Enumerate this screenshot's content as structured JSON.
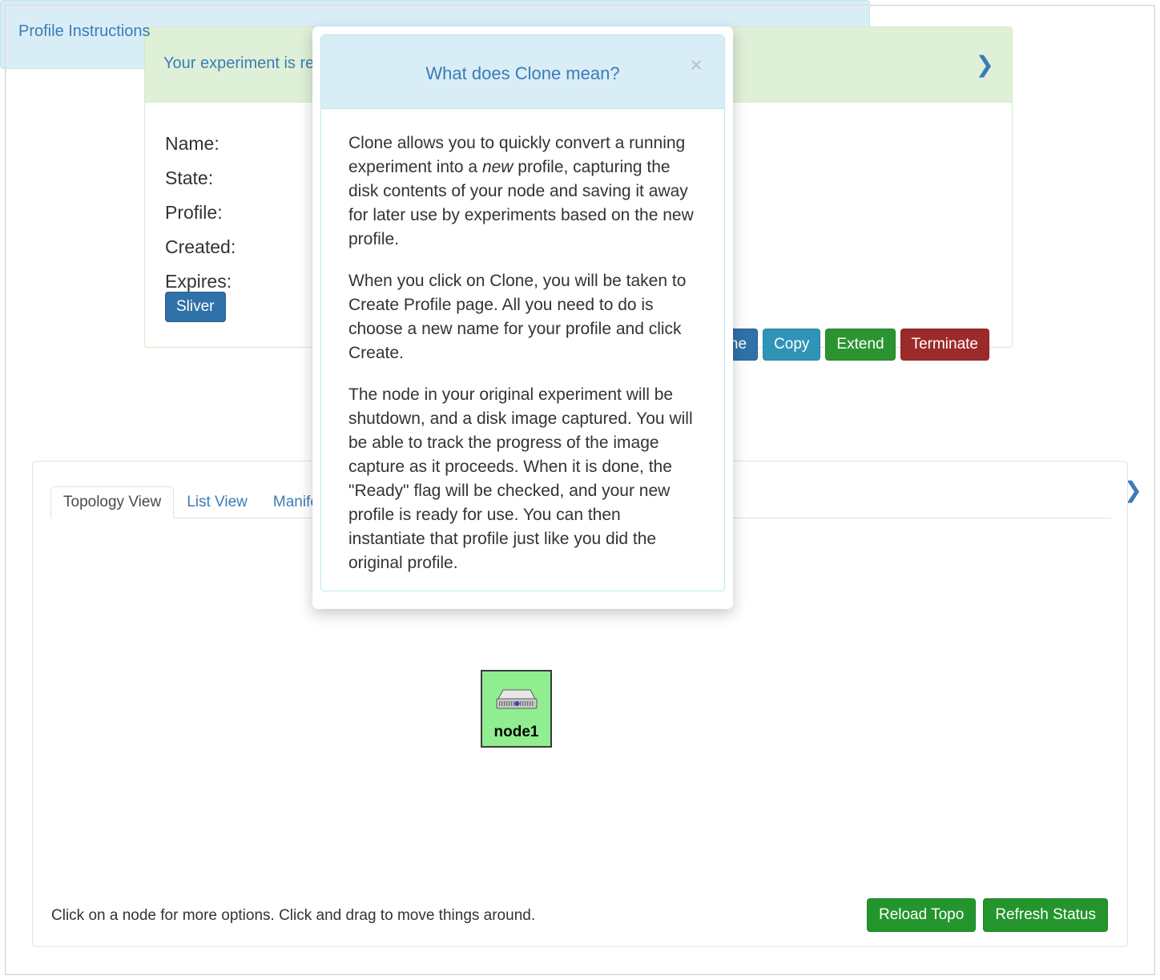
{
  "status_panel": {
    "heading": "Your experiment is ready!",
    "chevron_icon": "chevron-right-icon",
    "info_labels": [
      "Name:",
      "State:",
      "Profile:",
      "Created:",
      "Expires:"
    ],
    "sliver_button": "Sliver",
    "actions": [
      {
        "label": "Clone",
        "style": "primary",
        "color": "#3071a9"
      },
      {
        "label": "Copy",
        "style": "info",
        "color": "#2f94b7"
      },
      {
        "label": "Extend",
        "style": "success",
        "color": "#2b9430"
      },
      {
        "label": "Terminate",
        "style": "danger",
        "color": "#9c2a2a"
      }
    ]
  },
  "instructions_panel": {
    "heading": "Profile Instructions",
    "chevron_icon": "chevron-right-icon"
  },
  "topology": {
    "tabs": [
      {
        "label": "Topology View",
        "active": true
      },
      {
        "label": "List View",
        "active": false
      },
      {
        "label": "Manifest",
        "active": false
      }
    ],
    "nodes": [
      {
        "label": "node1",
        "color": "#90ee90",
        "icon": "server-node-icon"
      }
    ],
    "footer_text": "Click on a node for more options. Click and drag to move things around.",
    "footer_buttons": [
      {
        "label": "Reload Topo"
      },
      {
        "label": "Refresh Status"
      }
    ]
  },
  "modal": {
    "title": "What does Clone mean?",
    "close_icon": "close-icon",
    "close_label": "×",
    "paragraphs": {
      "p1_a": "Clone allows you to quickly convert a running experiment into a ",
      "p1_em": "new",
      "p1_b": " profile, capturing the disk contents of your node and saving it away for later use by experiments based on the new profile.",
      "p2": "When you click on Clone, you will be taken to Create Profile page. All you need to do is choose a new name for your profile and click Create.",
      "p3": "The node in your original experiment will be shutdown, and a disk image captured. You will be able to track the progress of the image capture as it proceeds. When it is done, the \"Ready\" flag will be checked, and your new profile is ready for use. You can then instantiate that profile just like you did the original profile."
    }
  },
  "theme": {
    "panel_success_bg": "#dff0d8",
    "panel_success_border": "#d6e9c6",
    "panel_info_bg": "#d9edf7",
    "panel_info_border": "#bce8f1",
    "link_blue": "#3c7cb5",
    "node_green": "#90ee90"
  }
}
